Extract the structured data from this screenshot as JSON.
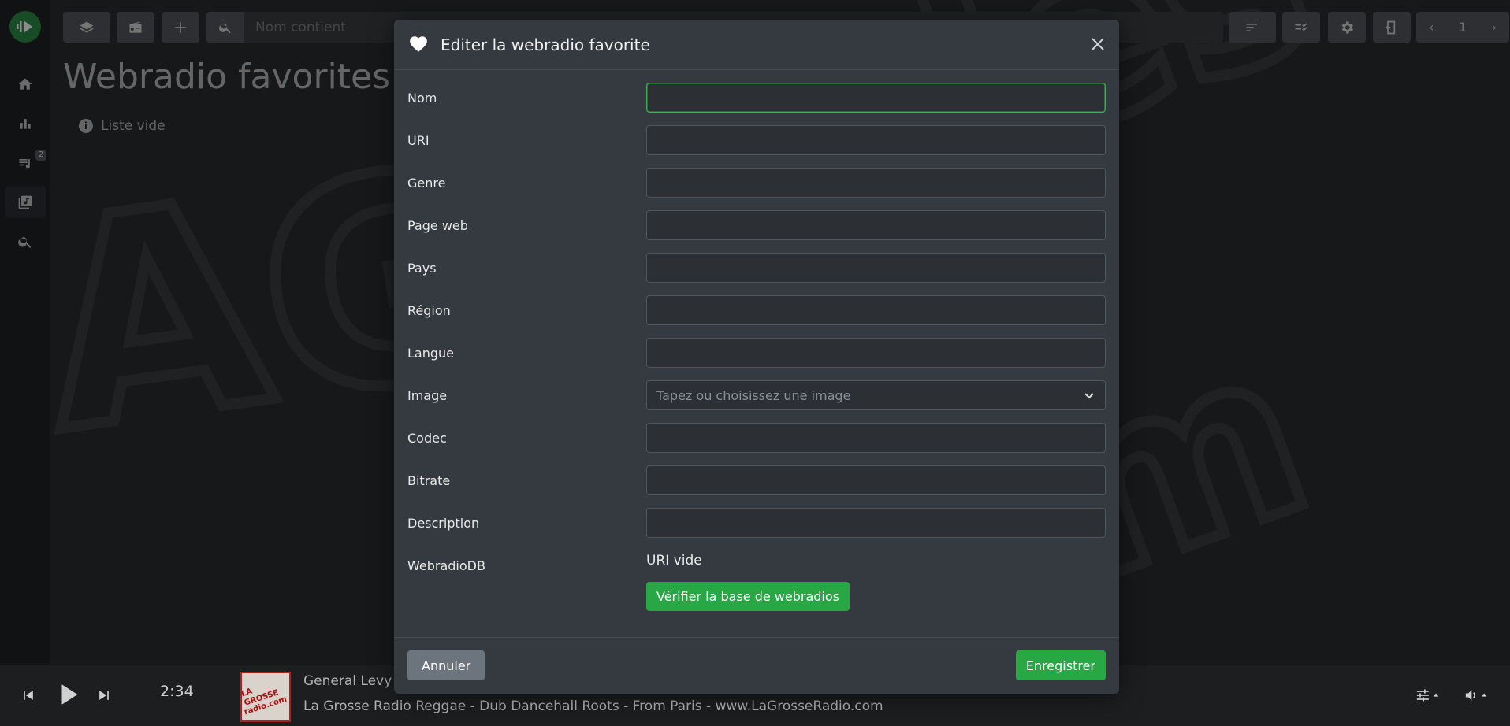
{
  "app": {
    "page_title": "Webradio favorites",
    "empty_note": "Liste vide",
    "search": {
      "placeholder": "Nom contient"
    },
    "queue_badge": "2",
    "pager": {
      "page": "1"
    }
  },
  "modal": {
    "title": "Editer la webradio favorite",
    "fields": [
      {
        "label": "Nom",
        "value": ""
      },
      {
        "label": "URI",
        "value": ""
      },
      {
        "label": "Genre",
        "value": ""
      },
      {
        "label": "Page web",
        "value": ""
      },
      {
        "label": "Pays",
        "value": ""
      },
      {
        "label": "Région",
        "value": ""
      },
      {
        "label": "Langue",
        "value": ""
      },
      {
        "label": "Image",
        "placeholder": "Tapez ou choisissez une image"
      },
      {
        "label": "Codec",
        "value": ""
      },
      {
        "label": "Bitrate",
        "value": ""
      },
      {
        "label": "Description",
        "value": ""
      }
    ],
    "webradiodb": {
      "label": "WebradioDB",
      "status": "URI vide",
      "verify_label": "Vérifier la base de webradios"
    },
    "cancel_label": "Annuler",
    "save_label": "Enregistrer"
  },
  "player": {
    "elapsed": "2:34",
    "title": "General Levy -",
    "subtitle": "La Grosse Radio Reggae - Dub Dancehall Roots - From Paris - www.LaGrosseRadio.com",
    "cover_text": [
      "LA GROSSE",
      "radio.com"
    ]
  },
  "colors": {
    "accent": "#28a745",
    "modal_bg": "#343a40",
    "secondary": "#6c757d"
  }
}
